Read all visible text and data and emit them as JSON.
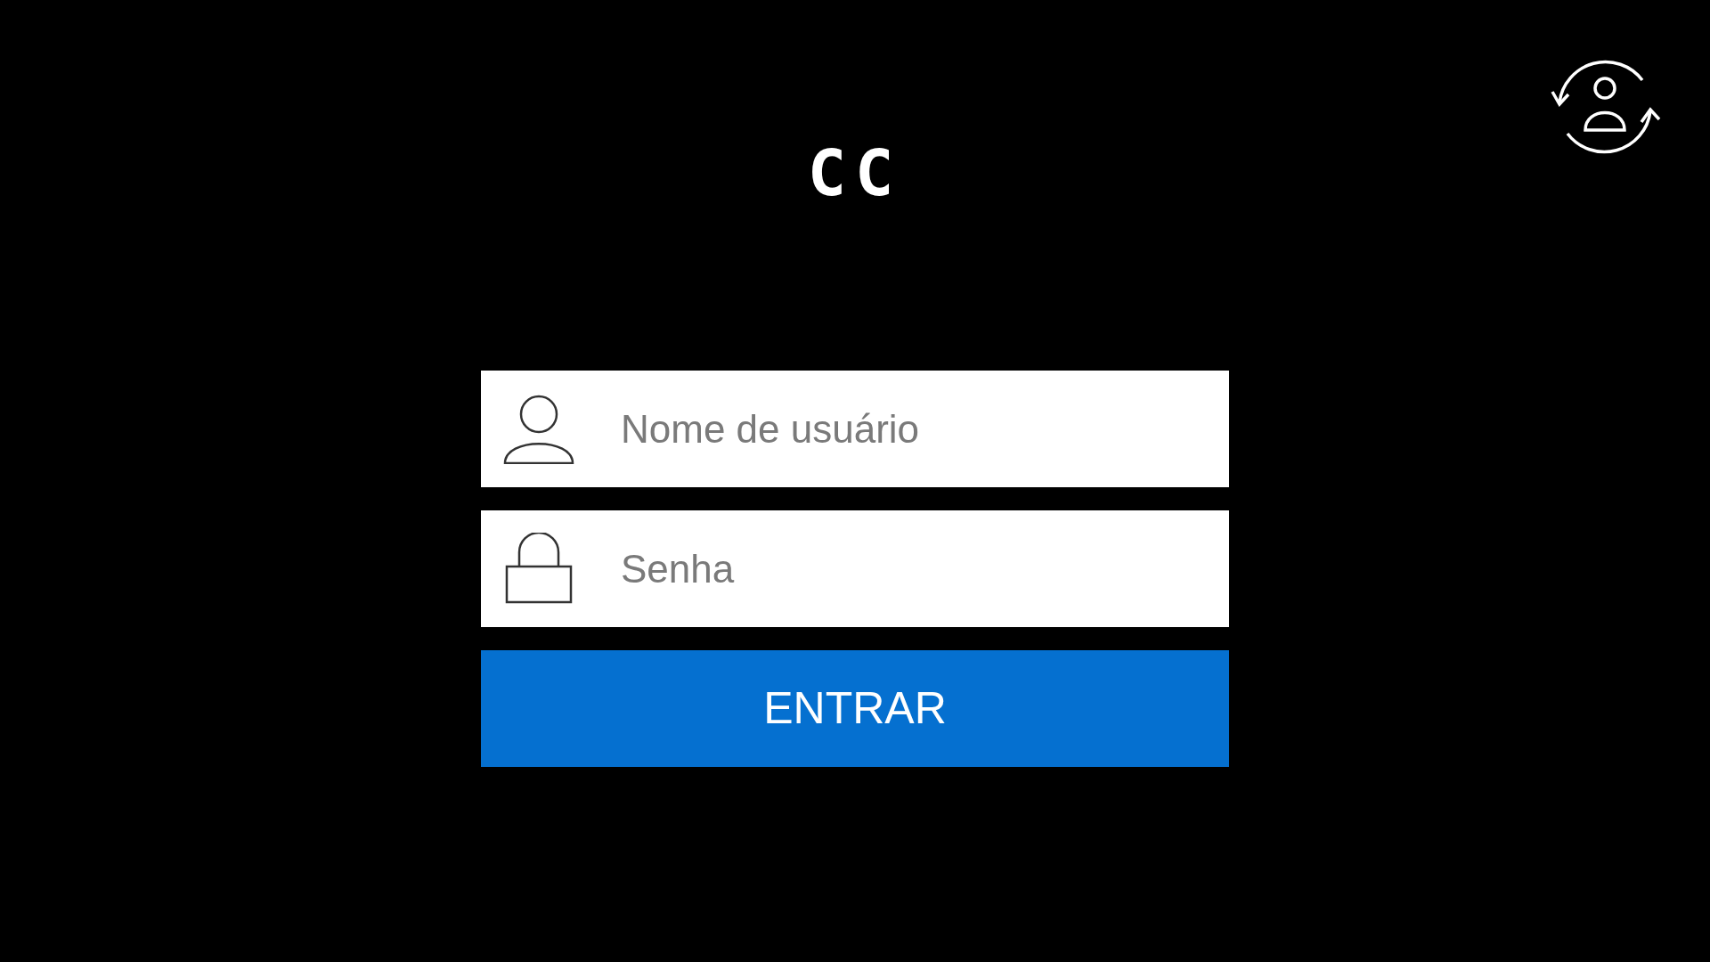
{
  "logo": {
    "text": "CC"
  },
  "fields": [
    {
      "kind": "user",
      "placeholder": "Nome de usuário"
    },
    {
      "kind": "password",
      "placeholder": "Senha"
    }
  ],
  "submit": {
    "label": "ENTRAR"
  }
}
